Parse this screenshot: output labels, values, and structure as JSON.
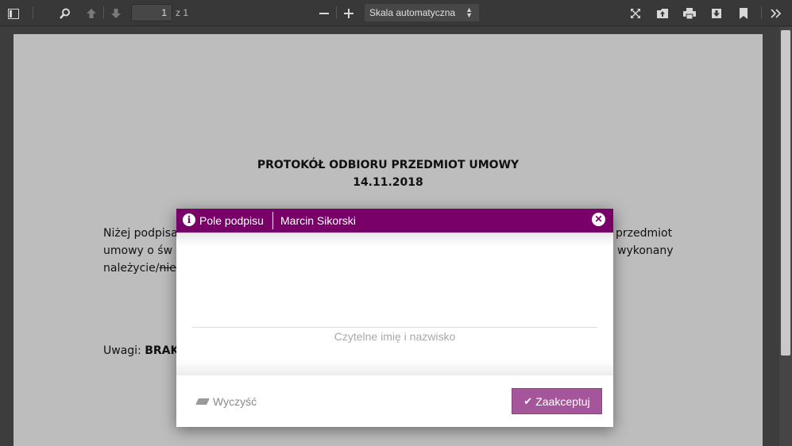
{
  "toolbar": {
    "page_number": "1",
    "page_total": "z 1",
    "zoom_label": "Skala automatyczna",
    "icons": {
      "sidebar": "sidebar-toggle-icon",
      "search": "search-icon",
      "prev": "arrow-up-icon",
      "next": "arrow-down-icon",
      "zoom_out": "minus-icon",
      "zoom_in": "plus-icon",
      "presentation": "fullscreen-icon",
      "open": "open-file-icon",
      "print": "print-icon",
      "download": "download-icon",
      "bookmark": "bookmark-icon",
      "tools": "double-chevron-right-icon"
    }
  },
  "document": {
    "title": "PROTOKÓŁ ODBIORU PRZEDMIOT UMOWY",
    "date": "14.11.2018",
    "para_line1_left": "Niżej podpisa",
    "para_line1_right": "przedmiot",
    "para_line2_left": "umowy o św",
    "para_line2_right": "wykonany",
    "para_line3_a": "należycie/",
    "para_line3_strike": "nie",
    "remarks_label": "Uwagi: ",
    "remarks_value": "BRAK"
  },
  "modal": {
    "header_title": "Pole podpisu",
    "header_name": "Marcin Sikorski",
    "signature_caption": "Czytelne imię i nazwisko",
    "clear_label": "Wyczyść",
    "accept_label": "Zaakceptuj",
    "colors": {
      "header": "#780068",
      "accept": "#a5569a"
    }
  }
}
